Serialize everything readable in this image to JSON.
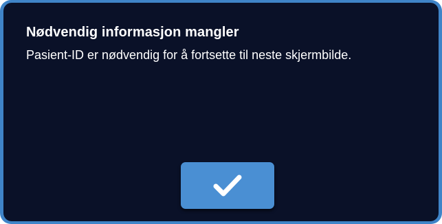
{
  "dialog": {
    "title": "Nødvendig informasjon mangler",
    "message": "Pasient-ID er nødvendig for å fortsette til neste skjermbilde.",
    "confirm_icon": "checkmark-icon"
  },
  "colors": {
    "frame": "#3f84c8",
    "background": "#0a1128",
    "button": "#4a8fd3",
    "text": "#ffffff"
  }
}
